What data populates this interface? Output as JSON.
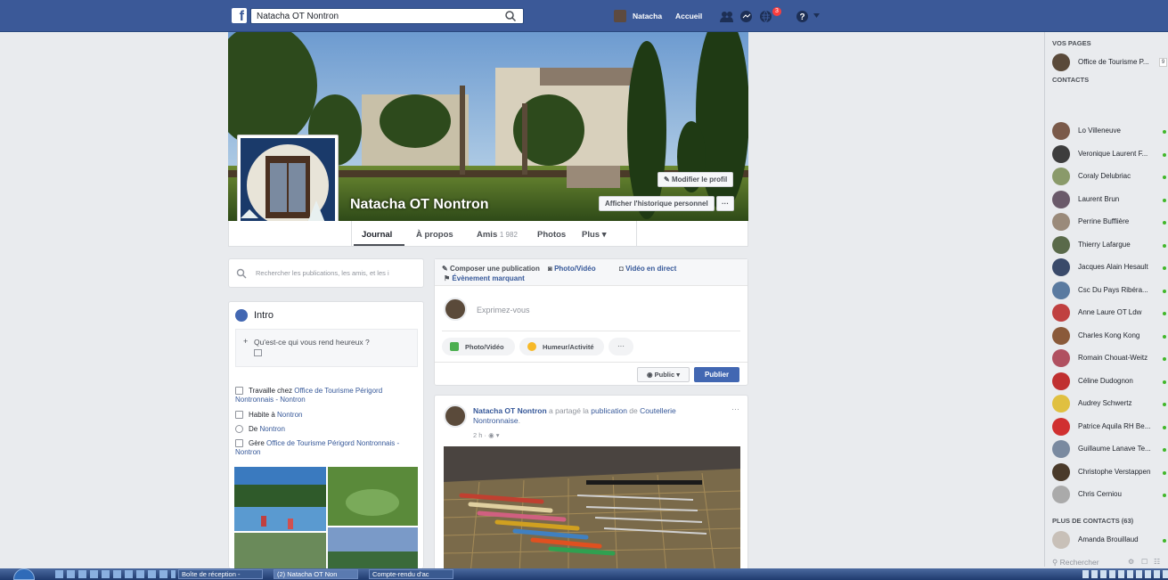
{
  "topbar": {
    "search_value": "Natacha OT Nontron",
    "user_name": "Natacha",
    "home_label": "Accueil",
    "notif_count": "3"
  },
  "profile": {
    "name": "Natacha OT Nontron",
    "edit_profile": "Modifier le profil",
    "activity_log": "Afficher l'historique personnel",
    "more_dots": "···"
  },
  "nav": {
    "journal": "Journal",
    "about": "À propos",
    "friends": "Amis",
    "friends_count": "1 982",
    "photos": "Photos",
    "more": "Plus ▾"
  },
  "left": {
    "search_placeholder": "Rechercher les publications, les amis, et les i",
    "intro_title": "Intro",
    "intro_prompt": "Qu'est-ce qui vous rend heureux ?",
    "work_prefix": "Travaille chez ",
    "work_link": "Office de Tourisme Périgord Nontronnais - Nontron",
    "lives_prefix": "Habite à ",
    "lives_link": "Nontron",
    "from_prefix": "De ",
    "from_link": "Nontron",
    "manages_prefix": "Gère ",
    "manages_link": "Office de Tourisme Périgord Nontronnais - Nontron"
  },
  "composer": {
    "tab_post": "Composer une publication",
    "tab_photo": "Photo/Vidéo",
    "tab_live": "Vidéo en direct",
    "tab_event": "Évènement marquant",
    "placeholder": "Exprimez-vous",
    "btn_photo": "Photo/Vidéo",
    "btn_feeling": "Humeur/Activité",
    "btn_more": "···",
    "privacy": "Public ▾",
    "publish": "Publier"
  },
  "post": {
    "author": "Natacha OT Nontron",
    "action_text": " a partagé la ",
    "action_link": "publication",
    "action_of": " de ",
    "page_link": "Coutellerie Nontronnaise",
    "page_end": ".",
    "time": "2 h · ◉ ▾",
    "more": "···"
  },
  "sidebar": {
    "pages_header": "VOS PAGES",
    "page_name": "Office de Tourisme P...",
    "page_count": "9",
    "contacts_header": "CONTACTS",
    "contacts": [
      {
        "name": "Lo Villeneuve",
        "color": "#7a5a4a"
      },
      {
        "name": "Veronique Laurent F...",
        "color": "#3d3d3d"
      },
      {
        "name": "Coraly Delubriac",
        "color": "#8a9a6a"
      },
      {
        "name": "Laurent Brun",
        "color": "#6a5a6a"
      },
      {
        "name": "Perrine Bufflière",
        "color": "#9a8a7a"
      },
      {
        "name": "Thierry Lafargue",
        "color": "#5a6a4a"
      },
      {
        "name": "Jacques Alain Hesault",
        "color": "#3a4a6a"
      },
      {
        "name": "Csc Du Pays Ribéra...",
        "color": "#5a7aa0"
      },
      {
        "name": "Anne Laure OT Ldw",
        "color": "#c04040"
      },
      {
        "name": "Charles Kong Kong",
        "color": "#8a5a3a"
      },
      {
        "name": "Romain Chouat-Weitz",
        "color": "#b05060"
      },
      {
        "name": "Céline Dudognon",
        "color": "#c03030"
      },
      {
        "name": "Audrey Schwertz",
        "color": "#e0c040"
      },
      {
        "name": "Patrice Aquila RH Be...",
        "color": "#d03030"
      },
      {
        "name": "Guillaume Lanave Te...",
        "color": "#7a8aa0"
      },
      {
        "name": "Christophe Verstappen",
        "color": "#4a3a2a"
      },
      {
        "name": "Chris Cerniou",
        "color": "#aaaaaa"
      }
    ],
    "more_header": "PLUS DE CONTACTS (63)",
    "more_contact": "Amanda Brouillaud",
    "search_placeholder": "Rechercher"
  },
  "taskbar": {
    "task1": "Boîte de réception -",
    "task2": "(2) Natacha OT Non",
    "task3": "Compte-rendu d'ac"
  }
}
